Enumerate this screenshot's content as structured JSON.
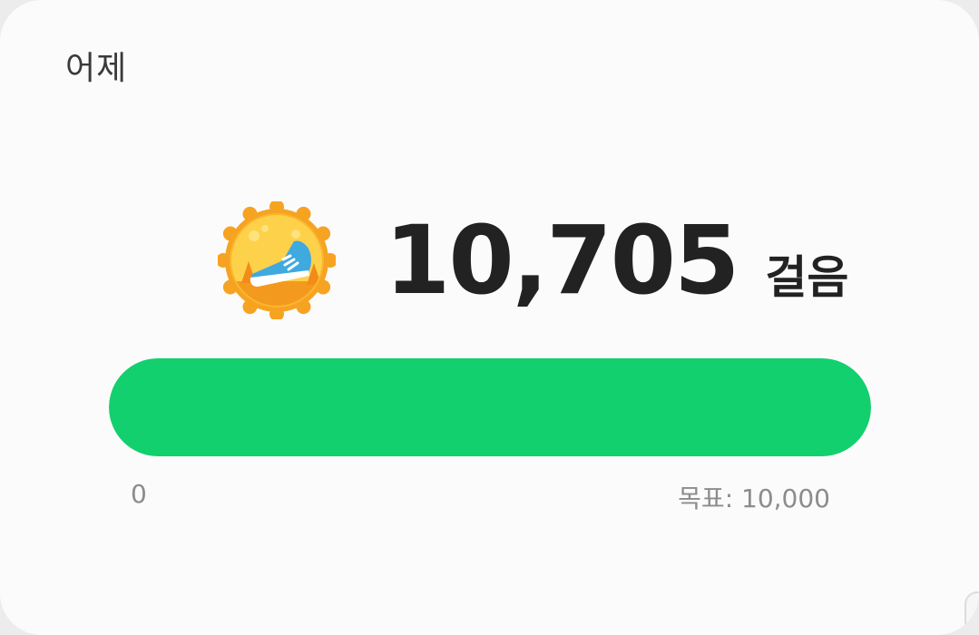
{
  "card": {
    "title": "어제"
  },
  "steps": {
    "value": "10,705",
    "unit": "걸음",
    "badge_icon": "running-shoe-badge-icon"
  },
  "progress": {
    "min_label": "0",
    "goal_label": "목표: 10,000",
    "fraction": 1.0,
    "fill_color": "#13d06e"
  }
}
